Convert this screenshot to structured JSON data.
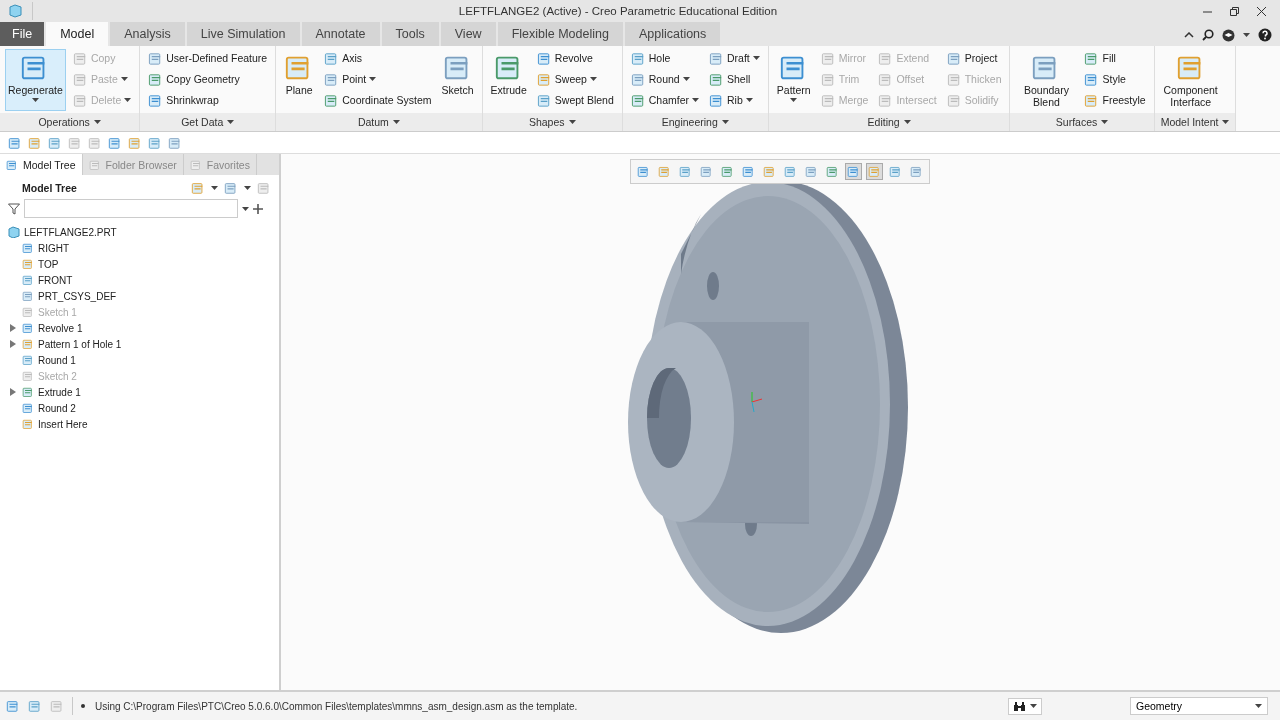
{
  "window": {
    "title": "LEFTFLANGE2 (Active) - Creo Parametric Educational Edition"
  },
  "menu_tabs": [
    {
      "label": "File",
      "kind": "file",
      "selected": false
    },
    {
      "label": "Model",
      "kind": "tab",
      "selected": true
    },
    {
      "label": "Analysis",
      "kind": "tab",
      "selected": false
    },
    {
      "label": "Live Simulation",
      "kind": "tab",
      "selected": false
    },
    {
      "label": "Annotate",
      "kind": "tab",
      "selected": false
    },
    {
      "label": "Tools",
      "kind": "tab",
      "selected": false
    },
    {
      "label": "View",
      "kind": "tab",
      "selected": false
    },
    {
      "label": "Flexible Modeling",
      "kind": "tab",
      "selected": false
    },
    {
      "label": "Applications",
      "kind": "tab",
      "selected": false
    }
  ],
  "ribbon_groups": [
    {
      "label": "Operations",
      "columns": [
        [
          {
            "label": "Regenerate",
            "kind": "large",
            "disabled": false,
            "dropdown": true,
            "highlighted": true
          }
        ],
        [
          {
            "label": "Copy",
            "kind": "small",
            "disabled": true,
            "dropdown": false,
            "highlighted": false
          },
          {
            "label": "Paste",
            "kind": "small",
            "disabled": true,
            "dropdown": true,
            "highlighted": false
          },
          {
            "label": "Delete",
            "kind": "small",
            "disabled": true,
            "dropdown": true,
            "highlighted": false
          }
        ]
      ]
    },
    {
      "label": "Get Data",
      "columns": [
        [
          {
            "label": "User-Defined Feature",
            "kind": "small",
            "disabled": false,
            "dropdown": false,
            "highlighted": false
          },
          {
            "label": "Copy Geometry",
            "kind": "small",
            "disabled": false,
            "dropdown": false,
            "highlighted": false
          },
          {
            "label": "Shrinkwrap",
            "kind": "small",
            "disabled": false,
            "dropdown": false,
            "highlighted": false
          }
        ]
      ]
    },
    {
      "label": "Datum",
      "columns": [
        [
          {
            "label": "Plane",
            "kind": "large",
            "disabled": false,
            "dropdown": false,
            "highlighted": false
          }
        ],
        [
          {
            "label": "Axis",
            "kind": "small",
            "disabled": false,
            "dropdown": false,
            "highlighted": false
          },
          {
            "label": "Point",
            "kind": "small",
            "disabled": false,
            "dropdown": true,
            "highlighted": false
          },
          {
            "label": "Coordinate System",
            "kind": "small",
            "disabled": false,
            "dropdown": false,
            "highlighted": false
          }
        ],
        [
          {
            "label": "Sketch",
            "kind": "large",
            "disabled": false,
            "dropdown": false,
            "highlighted": false
          }
        ]
      ]
    },
    {
      "label": "Shapes",
      "columns": [
        [
          {
            "label": "Extrude",
            "kind": "large",
            "disabled": false,
            "dropdown": false,
            "highlighted": false
          }
        ],
        [
          {
            "label": "Revolve",
            "kind": "small",
            "disabled": false,
            "dropdown": false,
            "highlighted": false
          },
          {
            "label": "Sweep",
            "kind": "small",
            "disabled": false,
            "dropdown": true,
            "highlighted": false
          },
          {
            "label": "Swept Blend",
            "kind": "small",
            "disabled": false,
            "dropdown": false,
            "highlighted": false
          }
        ]
      ]
    },
    {
      "label": "Engineering",
      "columns": [
        [
          {
            "label": "Hole",
            "kind": "small",
            "disabled": false,
            "dropdown": false,
            "highlighted": false
          },
          {
            "label": "Round",
            "kind": "small",
            "disabled": false,
            "dropdown": true,
            "highlighted": false
          },
          {
            "label": "Chamfer",
            "kind": "small",
            "disabled": false,
            "dropdown": true,
            "highlighted": false
          }
        ],
        [
          {
            "label": "Draft",
            "kind": "small",
            "disabled": false,
            "dropdown": true,
            "highlighted": false
          },
          {
            "label": "Shell",
            "kind": "small",
            "disabled": false,
            "dropdown": false,
            "highlighted": false
          },
          {
            "label": "Rib",
            "kind": "small",
            "disabled": false,
            "dropdown": true,
            "highlighted": false
          }
        ]
      ]
    },
    {
      "label": "Editing",
      "columns": [
        [
          {
            "label": "Pattern",
            "kind": "large",
            "disabled": false,
            "dropdown": true,
            "highlighted": false
          }
        ],
        [
          {
            "label": "Mirror",
            "kind": "small",
            "disabled": true,
            "dropdown": false,
            "highlighted": false
          },
          {
            "label": "Trim",
            "kind": "small",
            "disabled": true,
            "dropdown": false,
            "highlighted": false
          },
          {
            "label": "Merge",
            "kind": "small",
            "disabled": true,
            "dropdown": false,
            "highlighted": false
          }
        ],
        [
          {
            "label": "Extend",
            "kind": "small",
            "disabled": true,
            "dropdown": false,
            "highlighted": false
          },
          {
            "label": "Offset",
            "kind": "small",
            "disabled": true,
            "dropdown": false,
            "highlighted": false
          },
          {
            "label": "Intersect",
            "kind": "small",
            "disabled": true,
            "dropdown": false,
            "highlighted": false
          }
        ],
        [
          {
            "label": "Project",
            "kind": "small",
            "disabled": false,
            "dropdown": false,
            "highlighted": false
          },
          {
            "label": "Thicken",
            "kind": "small",
            "disabled": true,
            "dropdown": false,
            "highlighted": false
          },
          {
            "label": "Solidify",
            "kind": "small",
            "disabled": true,
            "dropdown": false,
            "highlighted": false
          }
        ]
      ]
    },
    {
      "label": "Surfaces",
      "columns": [
        [
          {
            "label": "Boundary Blend",
            "kind": "large",
            "disabled": false,
            "dropdown": false,
            "highlighted": false
          }
        ],
        [
          {
            "label": "Fill",
            "kind": "small",
            "disabled": false,
            "dropdown": false,
            "highlighted": false
          },
          {
            "label": "Style",
            "kind": "small",
            "disabled": false,
            "dropdown": false,
            "highlighted": false
          },
          {
            "label": "Freestyle",
            "kind": "small",
            "disabled": false,
            "dropdown": false,
            "highlighted": false
          }
        ]
      ]
    },
    {
      "label": "Model Intent",
      "columns": [
        [
          {
            "label": "Component Interface",
            "kind": "large",
            "disabled": false,
            "dropdown": false,
            "highlighted": false
          }
        ]
      ]
    }
  ],
  "panel_tabs": [
    {
      "label": "Model Tree",
      "selected": true
    },
    {
      "label": "Folder Browser",
      "selected": false
    },
    {
      "label": "Favorites",
      "selected": false
    }
  ],
  "model_tree": {
    "title": "Model Tree",
    "root": {
      "label": "LEFTFLANGE2.PRT",
      "children": [
        {
          "label": "RIGHT",
          "expandable": false,
          "disabled": false
        },
        {
          "label": "TOP",
          "expandable": false,
          "disabled": false
        },
        {
          "label": "FRONT",
          "expandable": false,
          "disabled": false
        },
        {
          "label": "PRT_CSYS_DEF",
          "expandable": false,
          "disabled": false
        },
        {
          "label": "Sketch 1",
          "expandable": false,
          "disabled": true
        },
        {
          "label": "Revolve 1",
          "expandable": true,
          "disabled": false
        },
        {
          "label": "Pattern 1 of Hole 1",
          "expandable": true,
          "disabled": false
        },
        {
          "label": "Round 1",
          "expandable": false,
          "disabled": false
        },
        {
          "label": "Sketch 2",
          "expandable": false,
          "disabled": true
        },
        {
          "label": "Extrude 1",
          "expandable": true,
          "disabled": false
        },
        {
          "label": "Round 2",
          "expandable": false,
          "disabled": false
        },
        {
          "label": "Insert Here",
          "expandable": false,
          "disabled": false
        }
      ]
    }
  },
  "view_toolbar": [
    {
      "on": false
    },
    {
      "on": false
    },
    {
      "on": false
    },
    {
      "on": false
    },
    {
      "on": false
    },
    {
      "on": false
    },
    {
      "on": false
    },
    {
      "on": false
    },
    {
      "on": false
    },
    {
      "on": false
    },
    {
      "on": true
    },
    {
      "on": true
    },
    {
      "on": false
    },
    {
      "on": false
    }
  ],
  "status_bar": {
    "message": "Using C:\\Program Files\\PTC\\Creo 5.0.6.0\\Common Files\\templates\\mmns_asm_design.asm as the template.",
    "filter": "Geometry"
  }
}
